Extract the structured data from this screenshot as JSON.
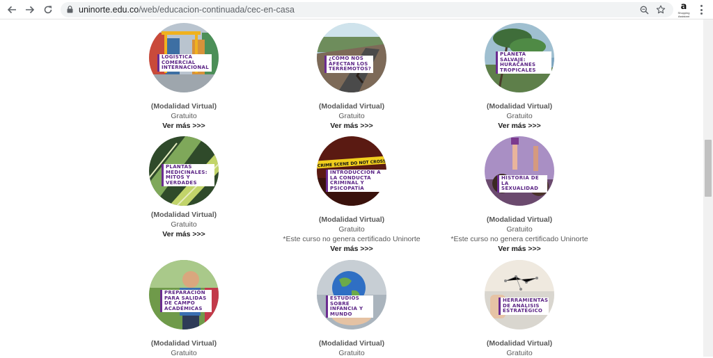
{
  "browser": {
    "url_domain": "uninorte.edu.co",
    "url_path": "/web/educacion-continuada/cec-en-casa",
    "extension_label": "a",
    "extension_sub": "Shopping Assistant"
  },
  "common": {
    "modality": "(Modalidad Virtual)",
    "price": "Gratuito",
    "more": "Ver más >>>",
    "cert_note": "*Este curso no genera certificado Uninorte"
  },
  "courses": [
    {
      "title": "LOGÍSTICA COMERCIAL INTERNACIONAL"
    },
    {
      "title": "¿CÓMO NOS AFECTAN LOS TERREMOTOS?"
    },
    {
      "title": "PLANETA SALVAJE: HURACANES TROPICALES"
    },
    {
      "title": "PLANTAS MEDICINALES: MITOS Y VERDADES"
    },
    {
      "title": "INTRODUCCIÓN A LA CONDUCTA CRIMINAL Y PSICOPATÍA"
    },
    {
      "title": "HISTORIA DE LA SEXUALIDAD"
    },
    {
      "title": "PREPARACIÓN PARA SALIDAS DE CAMPO ACADÉMICAS"
    },
    {
      "title": "ESTUDIOS SOBRE INFANCIA Y MUNDO"
    },
    {
      "title": "HERRAMIENTAS DE ANÁLISIS ESTRATÉGICO"
    }
  ],
  "crime_tape_text": "CRIME SCENE DO NOT CROSS"
}
